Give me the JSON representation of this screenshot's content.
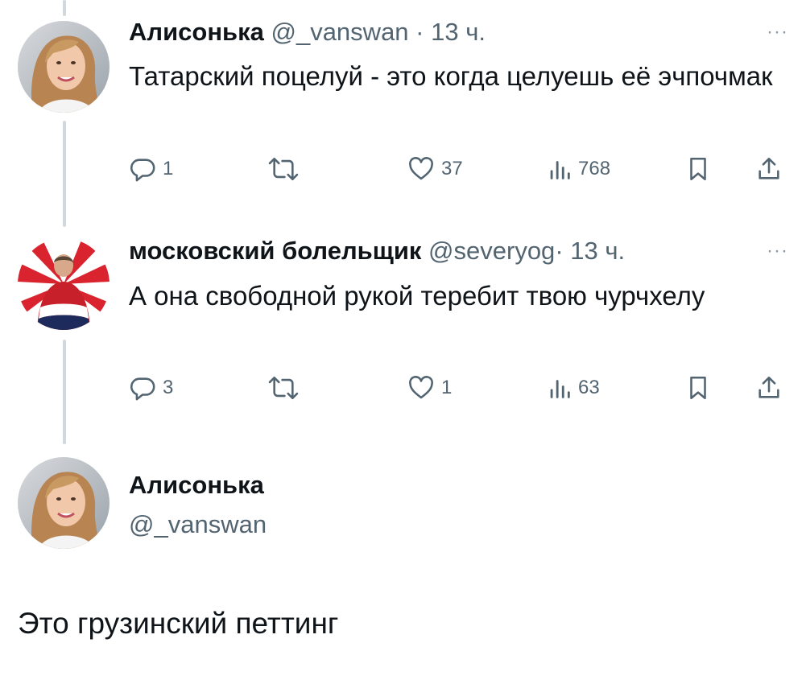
{
  "tweets": [
    {
      "name": "Алисонька",
      "handle": "@_vanswan",
      "dot": "·",
      "time": "13 ч.",
      "more": "···",
      "text": "Татарский поцелуй - это когда целуешь её эчпочмак",
      "stats": {
        "replies": "1",
        "retweets": "",
        "likes": "37",
        "views": "768"
      },
      "avatar_icon": "woman-photo-avatar"
    },
    {
      "name": "московский болельщик",
      "handle": "@severyog",
      "dot": "·",
      "time": "13 ч.",
      "more": "···",
      "text": "А она свободной рукой теребит твою чурчхелу",
      "stats": {
        "replies": "3",
        "retweets": "",
        "likes": "1",
        "views": "63"
      },
      "avatar_icon": "man-red-sunburst-avatar"
    }
  ],
  "quote": {
    "name": "Алисонька",
    "handle": "@_vanswan",
    "text": "Это грузинский петтинг",
    "avatar_icon": "woman-photo-avatar"
  },
  "icons": {
    "reply": "reply-icon",
    "retweet": "retweet-icon",
    "like": "like-icon",
    "views": "views-icon",
    "bookmark": "bookmark-icon",
    "share": "share-icon"
  },
  "colors": {
    "text": "#0f1419",
    "secondary": "#536471",
    "thread_line": "#cfd9de"
  }
}
